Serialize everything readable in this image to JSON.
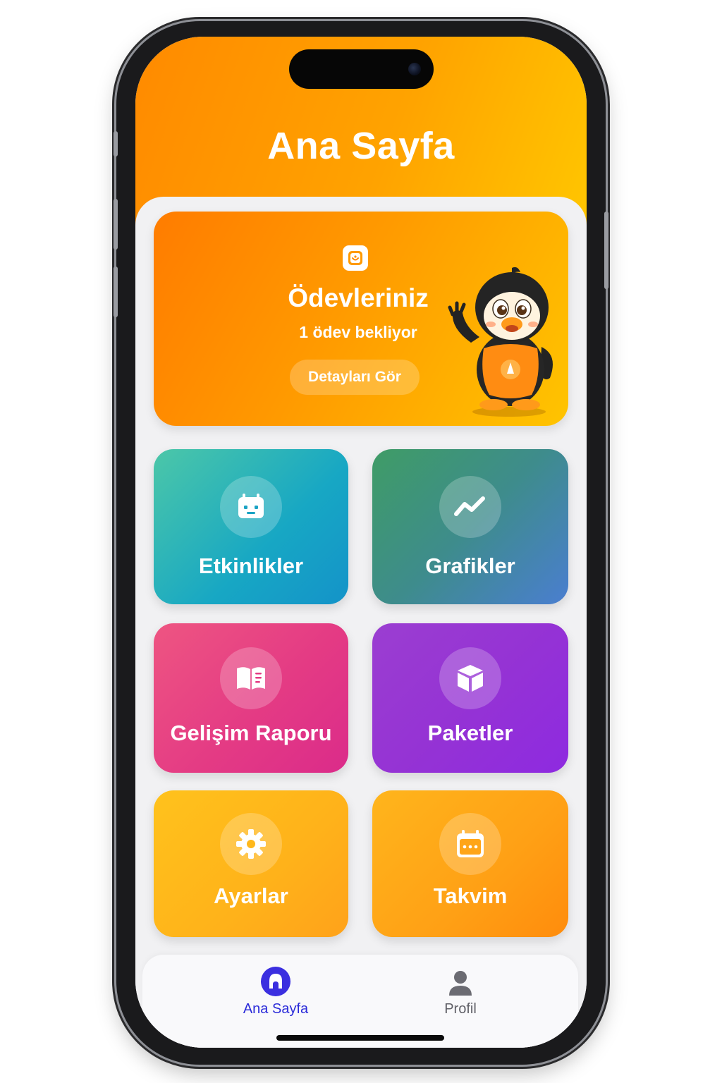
{
  "header": {
    "title": "Ana Sayfa"
  },
  "homework_card": {
    "icon": "homework-badge-icon",
    "title": "Ödevleriniz",
    "subtitle": "1 ödev bekliyor",
    "button_label": "Detayları Gör",
    "mascot": "penguin-mascot"
  },
  "tiles": [
    {
      "label": "Etkinlikler",
      "icon": "activity-calendar-icon",
      "colors": [
        "#4cc7a8",
        "#1493c9"
      ]
    },
    {
      "label": "Grafikler",
      "icon": "trend-chart-icon",
      "colors": [
        "#3f9c66",
        "#4a7ed0"
      ]
    },
    {
      "label": "Gelişim Raporu",
      "icon": "open-book-icon",
      "colors": [
        "#ee5582",
        "#db2b8a"
      ]
    },
    {
      "label": "Paketler",
      "icon": "package-box-icon",
      "colors": [
        "#9b3ed1",
        "#8e2ae0"
      ]
    },
    {
      "label": "Ayarlar",
      "icon": "gear-icon",
      "colors": [
        "#ffc21c",
        "#ffa21a"
      ]
    },
    {
      "label": "Takvim",
      "icon": "calendar-icon",
      "colors": [
        "#ffb51c",
        "#ff8c0c"
      ]
    }
  ],
  "tab_bar": {
    "items": [
      {
        "label": "Ana Sayfa",
        "icon": "home-icon",
        "active": true,
        "color": "#2b2bd9"
      },
      {
        "label": "Profil",
        "icon": "profile-icon",
        "active": false,
        "color": "#5f5f66"
      }
    ]
  },
  "theme": {
    "header_gradient": [
      "#ff8a00",
      "#ffc800"
    ],
    "background": "#efeff1"
  }
}
